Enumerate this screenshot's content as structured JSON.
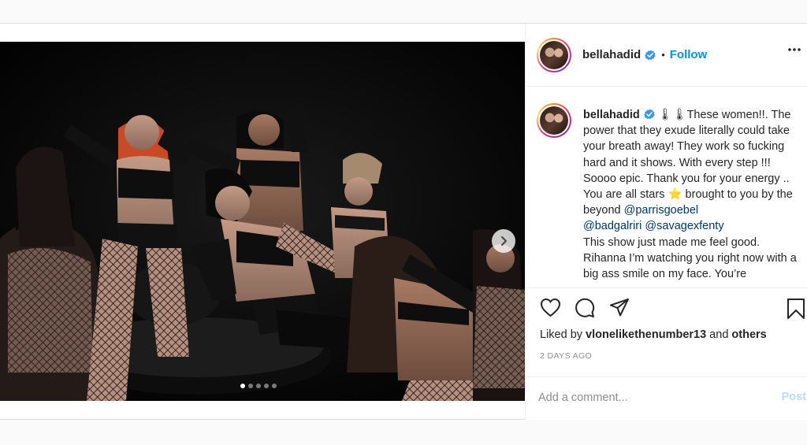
{
  "post": {
    "username": "bellahadid",
    "follow_label": "Follow",
    "bullet": "•",
    "caption": {
      "username": "bellahadid",
      "p1": " 🌡🌡These women!!. The power that they exude literally could take your breath away! They work so fucking hard and it shows. With every step !!! Soooo epic. Thank you for your energy .. You are all stars ",
      "star": "⭐",
      "p2": " brought to you by the beyond ",
      "mention1": "@parrisgoebel",
      "mention2": "@badgalriri",
      "mention3": "@savagexfenty",
      "p3": "This show just made me feel good. Rihanna I’m watching you right now with a big ass smile on my face. You’re"
    },
    "liked_prefix": "Liked by ",
    "liked_user": "vlonelikethenumber13",
    "liked_and": " and ",
    "liked_others": "others",
    "timestamp": "2 DAYS AGO",
    "comment_placeholder": "Add a comment...",
    "post_label": "Post",
    "carousel_index": 1,
    "carousel_count": 5
  },
  "icons": {
    "verified": "verified-badge-icon",
    "more": "more-options-icon",
    "like": "heart-icon",
    "comment": "comment-bubble-icon",
    "share": "paper-plane-icon",
    "save": "bookmark-icon",
    "next": "chevron-right-icon"
  },
  "colors": {
    "link_blue": "#0095f6",
    "mention": "#00376b",
    "post_disabled": "#b2dffc",
    "muted": "#8e8e8e"
  }
}
